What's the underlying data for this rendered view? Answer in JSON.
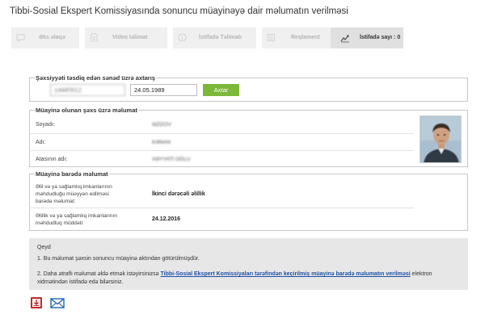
{
  "page": {
    "title": "Tibbi-Sosial Ekspert Komissiyasında sonuncu müayinəyə dair məlumatın verilməsi"
  },
  "toolbar": {
    "buttons": [
      {
        "label": "Əks əlaqə",
        "icon": "feedback-icon"
      },
      {
        "label": "Video təlimat",
        "icon": "document-icon"
      },
      {
        "label": "İstifadə Təlimatı",
        "icon": "info-icon"
      },
      {
        "label": "Reqlament",
        "icon": "list-icon"
      }
    ],
    "stats": {
      "label": "İstifadə sayı :",
      "value": "0",
      "icon": "chart-trend-icon"
    }
  },
  "search": {
    "legend": "Şəxsiyyəti təsdiq edən sənəd üzrə axtarış",
    "doc_number": "14WFR12",
    "birth_date": "24.05.1989",
    "button_label": "Axtar"
  },
  "person": {
    "legend": "Müayinə olunan şəxs üzrə məlumat",
    "fields": [
      {
        "label": "Soyadı:",
        "value": "ƏZİZOV"
      },
      {
        "label": "Adı:",
        "value": "KƏNAN"
      },
      {
        "label": "Atasının adı:",
        "value": "XƏYYATİ OĞLU"
      }
    ]
  },
  "exam": {
    "legend": "Müayinə barədə məlumat",
    "fields": [
      {
        "label_lines": [
          "Əlil və ya sağlamlıq imkanlarının",
          "məhdudluğu müəyyən edilməsi",
          "barədə məlumat:"
        ],
        "value": "İkinci dərəcəli əlillik"
      },
      {
        "label_lines": [
          "Əlillik və ya sağlamlıq imkanlarının",
          "məhdudluq müddəti:"
        ],
        "value": "24.12.2016"
      }
    ]
  },
  "note": {
    "title": "Qeyd",
    "item1": "1. Bu məlumat şəxsin sonuncu müayinə aktından götürülmüşdür.",
    "item2_pre": "2. Daha ətraflı məlumat əldə etmək istəyirsinizsə ",
    "item2_link": "Tibbi-Sosial Ekspert Komissiyaları tərəfindən keçirilmiş müayinə barədə məlumatın verilməsi",
    "item2_post": " elektron xidmətindən istifadə edə bilərsiniz."
  },
  "actions": {
    "pdf_icon": "pdf-download-icon",
    "mail_icon": "mail-icon"
  },
  "colors": {
    "accent_green": "#7cb83a",
    "link_blue": "#1f4fa6",
    "note_bg": "#e7e7e7"
  }
}
